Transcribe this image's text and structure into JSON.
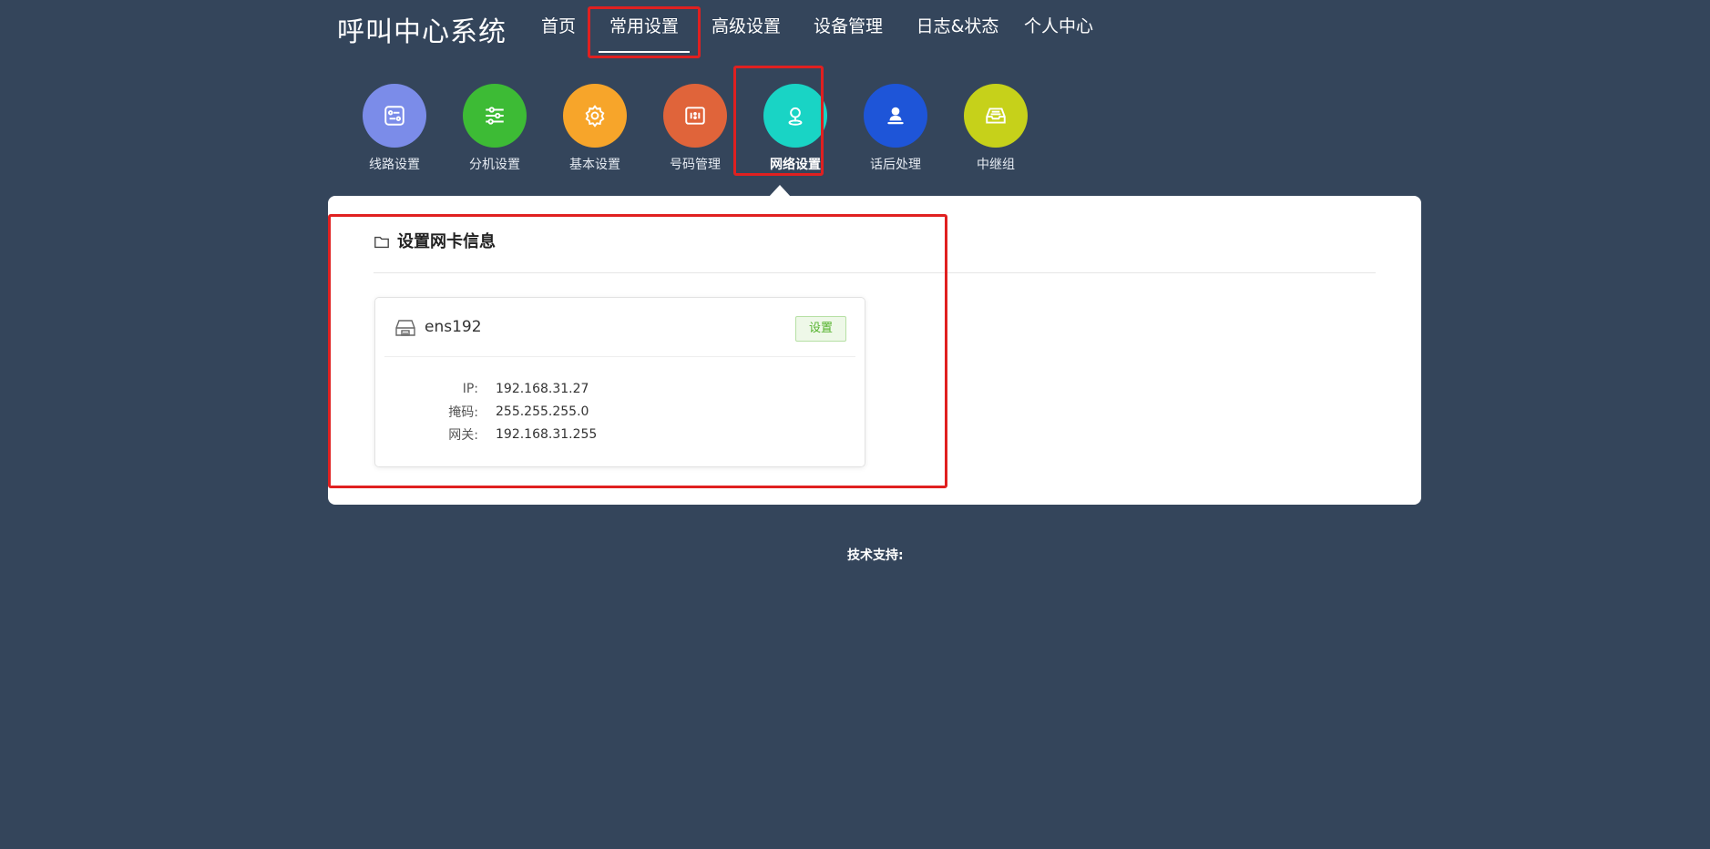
{
  "brand": "呼叫中心系统",
  "nav": [
    {
      "label": "首页",
      "active": false
    },
    {
      "label": "常用设置",
      "active": true
    },
    {
      "label": "高级设置",
      "active": false
    },
    {
      "label": "设备管理",
      "active": false
    },
    {
      "label": "日志&状态",
      "active": false
    },
    {
      "label": "个人中心",
      "active": false
    }
  ],
  "tools": [
    {
      "label": "线路设置",
      "icon": "route-settings-icon",
      "color": "#7b8ce9",
      "active": false
    },
    {
      "label": "分机设置",
      "icon": "sliders-icon",
      "color": "#3dbb35",
      "active": false
    },
    {
      "label": "基本设置",
      "icon": "gear-icon",
      "color": "#f7a52a",
      "active": false
    },
    {
      "label": "号码管理",
      "icon": "number-card-icon",
      "color": "#e0643a",
      "active": false
    },
    {
      "label": "网络设置",
      "icon": "location-pin-icon",
      "color": "#19d4c5",
      "active": true
    },
    {
      "label": "话后处理",
      "icon": "user-stamp-icon",
      "color": "#1e55d8",
      "active": false
    },
    {
      "label": "中继组",
      "icon": "inbox-tray-icon",
      "color": "#c6d11a",
      "active": false
    }
  ],
  "panel": {
    "title": "设置网卡信息",
    "card": {
      "name": "ens192",
      "button": "设置",
      "fields": [
        {
          "key": "IP:",
          "value": "192.168.31.27"
        },
        {
          "key": "掩码:",
          "value": "255.255.255.0"
        },
        {
          "key": "网关:",
          "value": "192.168.31.255"
        }
      ]
    }
  },
  "footer": "技术支持:"
}
